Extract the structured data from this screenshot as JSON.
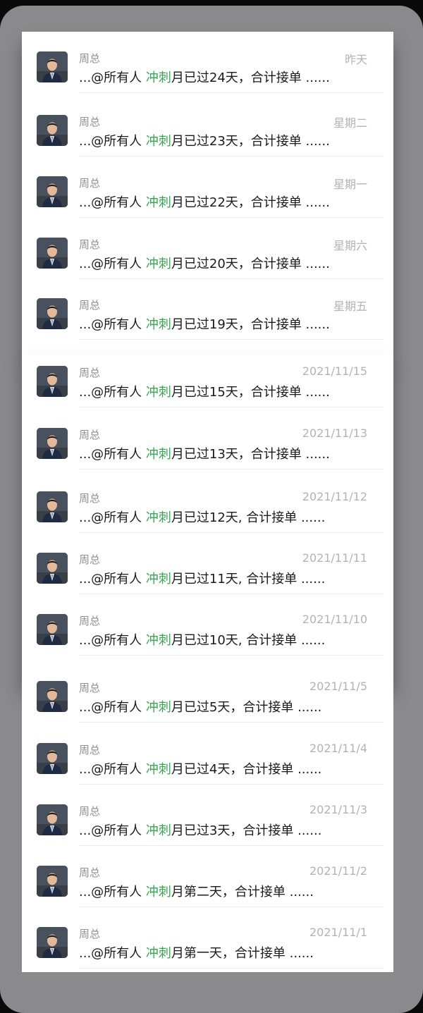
{
  "colors": {
    "keyword": "#35a84f",
    "time": "#b3b3b3",
    "sender": "#8f8f8f"
  },
  "avatar_icon": "person-in-suit-avatar",
  "messages": [
    {
      "sender": "周总",
      "time": "昨天",
      "prefix": "...@所有人 ",
      "keyword": "冲刺",
      "suffix": "月已过24天，合计接单 ......"
    },
    {
      "sender": "周总",
      "time": "星期二",
      "prefix": "...@所有人 ",
      "keyword": "冲刺",
      "suffix": "月已过23天，合计接单 ......"
    },
    {
      "sender": "周总",
      "time": "星期一",
      "prefix": "...@所有人 ",
      "keyword": "冲刺",
      "suffix": "月已过22天，合计接单 ......"
    },
    {
      "sender": "周总",
      "time": "星期六",
      "prefix": "...@所有人 ",
      "keyword": "冲刺",
      "suffix": "月已过20天，合计接单 ......"
    },
    {
      "sender": "周总",
      "time": "星期五",
      "prefix": "...@所有人 ",
      "keyword": "冲刺",
      "suffix": "月已过19天，合计接单 ......"
    },
    {
      "sender": "周总",
      "time": "2021/11/15",
      "prefix": "...@所有人 ",
      "keyword": "冲刺",
      "suffix": "月已过15天，合计接单 ......"
    },
    {
      "sender": "周总",
      "time": "2021/11/13",
      "prefix": "...@所有人 ",
      "keyword": "冲刺",
      "suffix": "月已过13天，合计接单 ......"
    },
    {
      "sender": "周总",
      "time": "2021/11/12",
      "prefix": "...@所有人 ",
      "keyword": "冲刺",
      "suffix": "月已过12天, 合计接单 ......"
    },
    {
      "sender": "周总",
      "time": "2021/11/11",
      "prefix": "...@所有人 ",
      "keyword": "冲刺",
      "suffix": "月已过11天, 合计接单 ......"
    },
    {
      "sender": "周总",
      "time": "2021/11/10",
      "prefix": "...@所有人 ",
      "keyword": "冲刺",
      "suffix": "月已过10天, 合计接单 ......"
    },
    {
      "sender": "周总",
      "time": "2021/11/5",
      "prefix": "...@所有人 ",
      "keyword": "冲刺",
      "suffix": "月已过5天，合计接单 ......"
    },
    {
      "sender": "周总",
      "time": "2021/11/4",
      "prefix": "...@所有人 ",
      "keyword": "冲刺",
      "suffix": "月已过4天，合计接单 ......"
    },
    {
      "sender": "周总",
      "time": "2021/11/3",
      "prefix": "...@所有人 ",
      "keyword": "冲刺",
      "suffix": "月已过3天，合计接单 ......"
    },
    {
      "sender": "周总",
      "time": "2021/11/2",
      "prefix": "...@所有人 ",
      "keyword": "冲刺",
      "suffix": "月第二天，合计接单 ......"
    },
    {
      "sender": "周总",
      "time": "2021/11/1",
      "prefix": "...@所有人 ",
      "keyword": "冲刺",
      "suffix": "月第一天，合计接单 ......"
    }
  ]
}
